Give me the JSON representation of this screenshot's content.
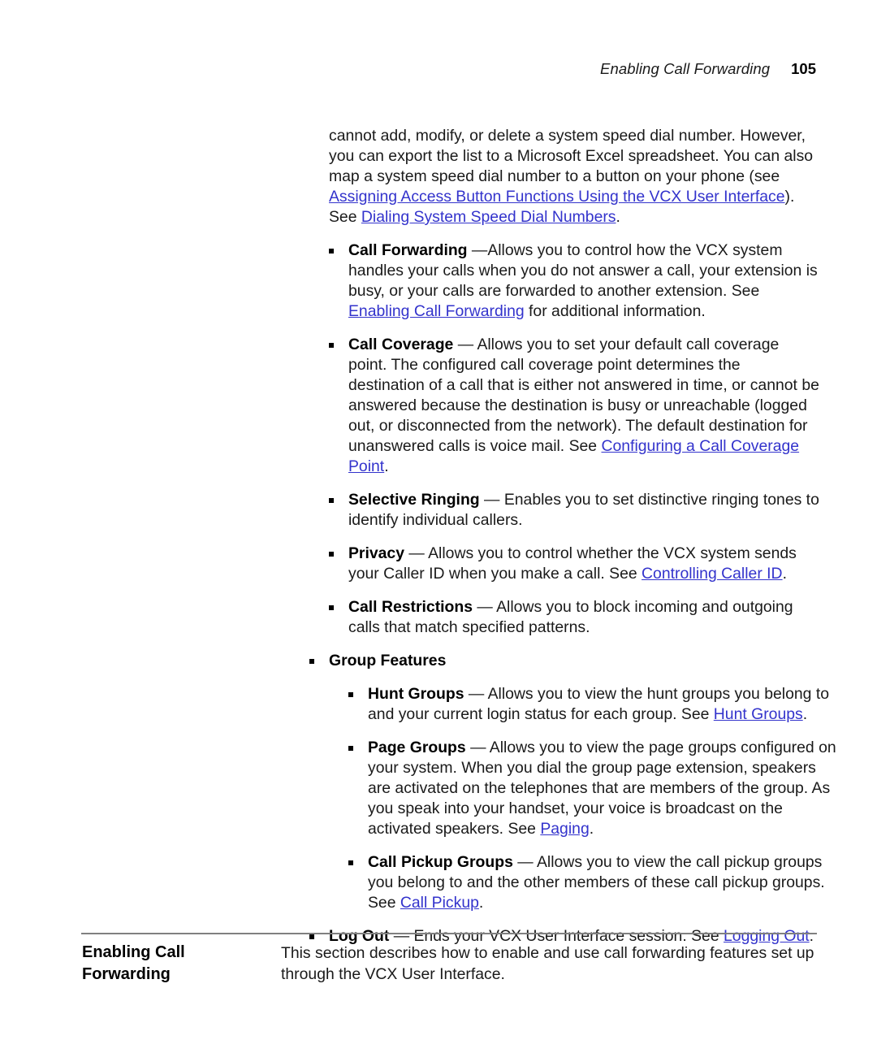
{
  "header": {
    "chapter": "Enabling Call Forwarding",
    "page_number": "105"
  },
  "colors": {
    "link": "#3333CC",
    "text": "#1A1A1A",
    "rule": "#808080"
  },
  "body": {
    "intro_paragraph": {
      "part1": "cannot add, modify, or delete a system speed dial number. However, you can export the list to a Microsoft Excel spreadsheet. You can also map a system speed dial number to a button on your phone (see ",
      "link1": "Assigning Access Button Functions Using the VCX User Interface",
      "part2": "). See ",
      "link2": "Dialing System Speed Dial Numbers",
      "part3": "."
    },
    "feature_bullets": [
      {
        "term": "Call Forwarding",
        "dash": " —",
        "text1": "Allows you to control how the VCX system handles your calls when you do not answer a call, your extension is busy, or your calls are forwarded to another extension. See ",
        "link": "Enabling Call Forwarding",
        "text2": " for additional information."
      },
      {
        "term": "Call Coverage",
        "dash": " — ",
        "text1": "Allows you to set your default call coverage point. The configured call coverage point determines the destination of a call that is either not answered in time, or cannot be answered because the destination is busy or unreachable (logged out, or disconnected from the network). The default destination for unanswered calls is voice mail. See ",
        "link": "Configuring a Call Coverage Point",
        "text2": "."
      },
      {
        "term": "Selective Ringing",
        "dash": " — ",
        "text1": "Enables you to set distinctive ringing tones to identify individual callers.",
        "link": "",
        "text2": ""
      },
      {
        "term": "Privacy",
        "dash": " — ",
        "text1": "Allows you to control whether the VCX system sends your Caller ID when you make a call. See ",
        "link": "Controlling Caller ID",
        "text2": "."
      },
      {
        "term": "Call Restrictions",
        "dash": " — ",
        "text1": "Allows you to block incoming and outgoing calls that match specified patterns.",
        "link": "",
        "text2": ""
      }
    ],
    "group_features": {
      "term": "Group Features",
      "sub_bullets": [
        {
          "term": "Hunt Groups",
          "dash": " — ",
          "text1": "Allows you to view the hunt groups you belong to and your current login status for each group. See ",
          "link": "Hunt Groups",
          "text2": "."
        },
        {
          "term": "Page Groups",
          "dash": " — ",
          "text1": "Allows you to view the page groups configured on your system. When you dial the group page extension, speakers are activated on the telephones that are members of the group. As you speak into your handset, your voice is broadcast on the activated speakers. See ",
          "link": "Paging",
          "text2": "."
        },
        {
          "term": "Call Pickup Groups",
          "dash": " — ",
          "text1": "Allows you to view the call pickup groups you belong to and the other members of these call pickup groups. See ",
          "link": "Call Pickup",
          "text2": "."
        }
      ]
    },
    "log_out_bullet": {
      "term": "Log Out",
      "dash": " — ",
      "text1": "Ends your VCX User Interface session. See ",
      "link": "Logging Out",
      "text2": "."
    }
  },
  "section": {
    "heading_line1": "Enabling Call",
    "heading_line2": "Forwarding",
    "paragraph": "This section describes how to enable and use call forwarding features set up through the VCX User Interface."
  }
}
